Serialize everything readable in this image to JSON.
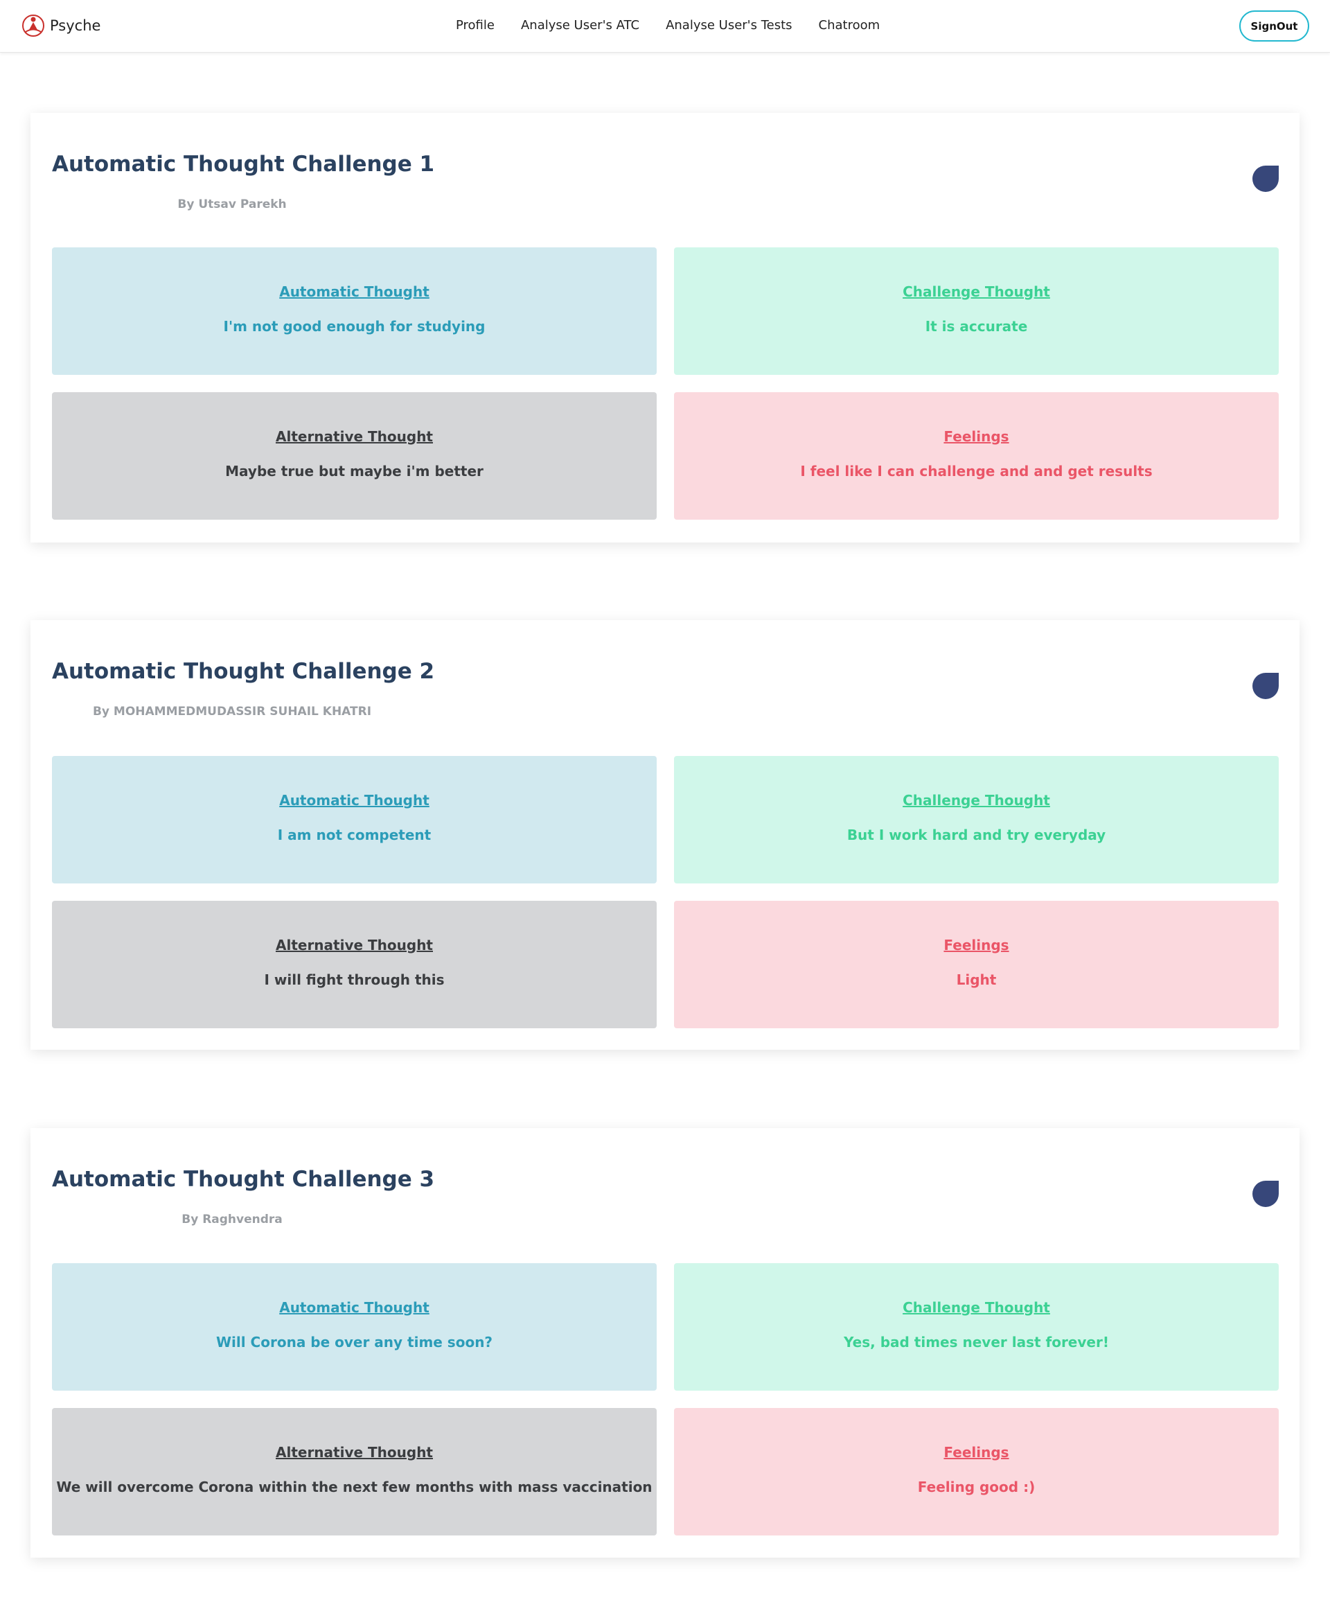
{
  "navbar": {
    "brand_name": "Psyche",
    "links": [
      "Profile",
      "Analyse User's ATC",
      "Analyse User's Tests",
      "Chatroom"
    ],
    "signout_label": "SignOut"
  },
  "cards": [
    {
      "title": "Automatic Thought Challenge 1",
      "author": "By Utsav Parekh",
      "automatic": {
        "label": "Automatic Thought",
        "value": "I'm not good enough for studying"
      },
      "challenge": {
        "label": "Challenge Thought",
        "value": "It is accurate"
      },
      "alternative": {
        "label": "Alternative Thought",
        "value": "Maybe true but maybe i'm better"
      },
      "feelings": {
        "label": "Feelings",
        "value": "I feel like I can challenge and and get results"
      }
    },
    {
      "title": "Automatic Thought Challenge 2",
      "author": "By MOHAMMEDMUDASSIR SUHAIL KHATRI",
      "automatic": {
        "label": "Automatic Thought",
        "value": "I am not competent"
      },
      "challenge": {
        "label": "Challenge Thought",
        "value": "But I work hard and try everyday"
      },
      "alternative": {
        "label": "Alternative Thought",
        "value": "I will fight through this"
      },
      "feelings": {
        "label": "Feelings",
        "value": "Light"
      }
    },
    {
      "title": "Automatic Thought Challenge 3",
      "author": "By Raghvendra",
      "automatic": {
        "label": "Automatic Thought",
        "value": "Will Corona be over any time soon?"
      },
      "challenge": {
        "label": "Challenge Thought",
        "value": "Yes, bad times never last forever!"
      },
      "alternative": {
        "label": "Alternative Thought",
        "value": "We will overcome Corona within the next few months with mass vaccination"
      },
      "feelings": {
        "label": "Feelings",
        "value": "Feeling good :)"
      }
    }
  ],
  "colors": {
    "title": "#2b4260",
    "automatic_bg": "#d1e9ef",
    "automatic_text": "#2b9cb8",
    "challenge_bg": "#d0f7ea",
    "challenge_text": "#3bd193",
    "alternative_bg": "#d5d6d8",
    "alternative_text": "#3b3d40",
    "feelings_bg": "#fbd9de",
    "feelings_text": "#ea5567",
    "accent": "#22b8cf",
    "marker": "#37477a"
  }
}
